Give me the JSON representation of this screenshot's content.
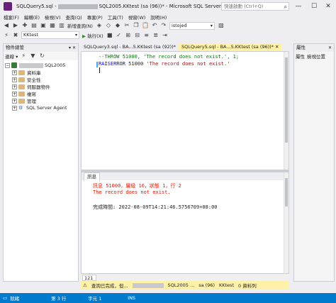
{
  "window": {
    "title_prefix": "SQLQuery5.sql -",
    "title_suffix": "SQL2005.KKtest (sa (96))* - Microsoft SQL Server Managem...",
    "quick_launch_placeholder": "快速啟動 (Ctrl+Q)",
    "minimize": "—",
    "maximize": "☐",
    "close": "✕"
  },
  "menu": [
    "檔案(F)",
    "編輯(E)",
    "檢視(V)",
    "查詢(Q)",
    "專案(P)",
    "工具(T)",
    "視窗(W)",
    "說明(H)"
  ],
  "toolbar1": {
    "new_query": "新增查詢(N)",
    "search_combo": "istojed"
  },
  "toolbar2": {
    "db_combo": "KKtest",
    "execute": "執行(X)"
  },
  "object_explorer": {
    "title": "物件總管",
    "connect": "連線 ▾",
    "server": "SQL2005",
    "nodes": [
      "資料庫",
      "安全性",
      "伺服器物件",
      "複寫",
      "管理",
      "SQL Server Agent"
    ]
  },
  "tabs": [
    {
      "label": "SQLQuery3.sql - BA...5.KKtest (sa (92))*"
    },
    {
      "label": "SQLQuery5.sql - BA...5.KKtest (sa (96))*  ✕"
    }
  ],
  "editor": {
    "line1": "--THROW 51000, 'The record does not exist.', 1;",
    "line2_kw": "RAISERROR",
    "line2_num": " 51000 ",
    "line2_str": "'The record does not exist.'"
  },
  "editor_zoom": "121 %",
  "results": {
    "tab": "訊息",
    "msg1": "訊息 51000，層級 16，狀態 1，行 2",
    "msg2": "The record does not exist.",
    "msg3": "完成時間: 2022-08-09T14:21:46.5756709+08:00"
  },
  "results_zoom": "121 %",
  "query_status": {
    "text": "查詢已完成，但...",
    "server": "SQL2005 ...",
    "login": "sa (96)",
    "db": "KKtest",
    "rows": "0 資料列"
  },
  "properties": {
    "title": "屬性",
    "tab1": "屬性",
    "tab2": "檢視位置"
  },
  "statusbar": {
    "ready": "就緒",
    "line": "第 3 行",
    "col": "字元 1",
    "ins": "INS"
  },
  "colors": {
    "accent": "#007acc",
    "active_tab": "#fff1a8",
    "error_text": "#e51400"
  }
}
